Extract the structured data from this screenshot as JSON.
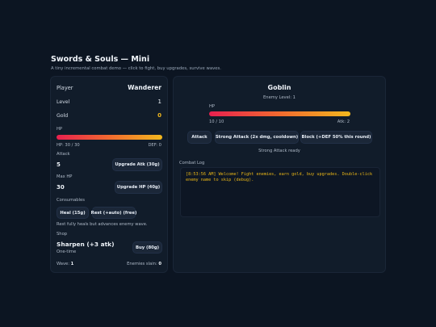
{
  "app": {
    "title": "Swords & Souls — Mini",
    "subtitle": "A tiny incremental combat demo — click to fight, buy upgrades, survive waves."
  },
  "player": {
    "label": "Player",
    "name": "Wanderer",
    "level_label": "Level",
    "level": "1",
    "gold_label": "Gold",
    "gold": "0",
    "hp_label": "HP",
    "hp_text": "HP: 30 / 30",
    "hp_fraction": 1.0,
    "def_text": "DEF: 0",
    "attack_label": "Attack",
    "attack": "5",
    "upgrade_atk": "Upgrade Atk (30g)",
    "maxhp_label": "Max HP",
    "maxhp": "30",
    "upgrade_hp": "Upgrade HP (40g)",
    "consumables_label": "Consumables",
    "heal_btn": "Heal (15g)",
    "rest_btn": "Rest (+auto) (free)",
    "rest_note": "Rest fully heals but advances enemy wave.",
    "shop_label": "Shop",
    "shop_item": "Sharpen (+3 atk)",
    "shop_item_sub": "One-time",
    "buy_btn": "Buy (80g)",
    "wave_label": "Wave:",
    "wave": "1",
    "slain_label": "Enemies slain:",
    "slain": "0"
  },
  "enemy": {
    "name": "Goblin",
    "level_text": "Enemy Level: 1",
    "hp_label": "HP",
    "hp_text": "10 / 10",
    "hp_fraction": 1.0,
    "atk_text": "Atk: 2",
    "attack_btn": "Attack",
    "strong_btn": "Strong Attack (2x dmg, cooldown)",
    "block_btn": "Block (+DEF 50% this round)",
    "status": "Strong Attack ready",
    "log_label": "Combat Log",
    "log_text": "[8:53:56 AM] Welcome! Fight enemies, earn gold, buy upgrades. Double-click enemy name to skip (debug)."
  },
  "colors": {
    "background": "#0c1522",
    "panel": "#111c2a",
    "gold": "#f2b81e",
    "hp_start": "#e8204f",
    "hp_end": "#f2b81e",
    "log_text": "#e7b416"
  }
}
